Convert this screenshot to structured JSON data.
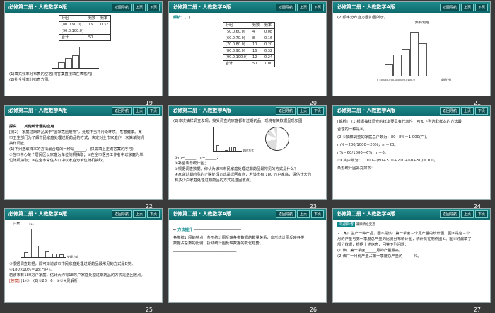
{
  "header": {
    "title": "必修第二册 · 人教数学A版",
    "nav": "返回导航",
    "prev": "上页",
    "next": "下页"
  },
  "slides": [
    {
      "num": "19",
      "table_head": [
        "分组",
        "频数",
        "频率"
      ],
      "rows": [
        [
          "[80.0,90.0)",
          "16",
          "0.32"
        ],
        [
          "[90.0,100.0]",
          "",
          ""
        ],
        [
          "合计",
          "50",
          ""
        ]
      ],
      "q1": "(1)填充频率分布表的空格(将答案直接填在表格内);",
      "q2": "(2)补全频率分布直方图。"
    },
    {
      "num": "20",
      "label": "解析",
      "text": "：(1)",
      "head": [
        "分组",
        "频数",
        "频率"
      ],
      "rows": [
        [
          "[50.0,60.0)",
          "4",
          "0.08"
        ],
        [
          "[60.0,70.0)",
          "8",
          "0.16"
        ],
        [
          "[70.0,80.0)",
          "10",
          "0.20"
        ],
        [
          "[80.0,90.0)",
          "16",
          "0.32"
        ],
        [
          "[90.0,100.0]",
          "12",
          "0.24"
        ],
        [
          "合计",
          "50",
          "1.00"
        ]
      ]
    },
    {
      "num": "21",
      "text": "(2)频率分布直方图如图所示。",
      "ylabel": "频率/组距",
      "xlabel": "成绩(分)",
      "xticks": "0 50.060.070.080.090.0100.0"
    },
    {
      "num": "22",
      "title": "探究二　其他统计图的应用",
      "lines": [
        "[例2]　家庭过期药品属于“国家危险废物”，处理不当将污染环境，危害健康。某",
        "市卫生部门为了解市民家庭处理过期药品的方式，决定对全市家庭作一次简单随机",
        "抽样调查。",
        "(1)下列选取样本的方法最合理的一种是______。(只需填上正确答案的序号)",
        "①在市中心某个居民区以家庭为单位随机抽取；②在全市医务工作者中以家庭为单",
        "位随机抽取；③在全市常住人口中以家庭为单位随机抽取。"
      ]
    },
    {
      "num": "23",
      "top": "(2)本次抽样调查发现，接受调查的家庭都有过期药品，现将有关数据呈现如图：",
      "pie_labels": [
        "A",
        "B",
        "C",
        "D",
        "E",
        "F"
      ],
      "chart_title": "处理方式",
      "lines": [
        "①m=______，n=______；",
        "②补全条形统计图；",
        "③根据调查数据，你认为该市市民家庭处理过期药品最常见的方式是什么？",
        "④家庭过期药品的正确处理方式是送回收点，若该市有 180 万户家庭，请估计大约",
        "有多少户家庭处理过期药品的方式是送回收点。"
      ]
    },
    {
      "num": "24",
      "lines": [
        "[解析]　(1)根据抽样调查的样本要具有代表性，可知下列选取样本的方法最",
        "合理的一种是③。",
        "(2)①抽样调查的家庭总户数为：80÷8%＝1 000(户)。",
        "m%＝200/1000＝20%，m＝20。",
        "n%＝60/1000＝6%，n＝6。",
        "②C类户数为：1 000－(80＋510＋200＋60＋50)＝100。",
        "条形统计图补充如下："
      ]
    },
    {
      "num": "25",
      "ylabel": "户数",
      "xlabel": "处理方式",
      "values": [
        "510",
        "200",
        "100",
        "80",
        "60",
        "50"
      ],
      "lines": [
        "③根据调查数据，即可知道该市市民家庭处理过期药品最常见的方式是B类。",
        "④180×10%＝18(万户)。",
        "若该市有180万户家庭，估计大约有18万户家庭处理过期药品的方式是送回收点。"
      ],
      "answer_label": "[答案]",
      "answer": "(1)③　(2)①20　6　②③④见解析"
    },
    {
      "num": "26",
      "title": "方法提升",
      "lines": [
        "各类统计图的特点：条形统计图反映各类数据的数量关系，扇形统计图反映各类",
        "数据占总数的比例，折线统计图反映数据的变化趋势。"
      ]
    },
    {
      "num": "27",
      "badge": "同源异考",
      "badge2": "·兼顾精准变通",
      "lines": [
        "2．某厂生产一种产品，图①是该厂第一季度三个月产量的统计图，图②是这三个",
        "月的产量与第一季度总产量的比例分布统计图，统计员在制作图①、图②时漏填了",
        "部分数据，根据上述信息，回答下列问题：",
        "(1)该厂第一季度______月的产量最高。",
        "(2)该厂一月份产量占第一季度总产量的______%。"
      ]
    }
  ]
}
